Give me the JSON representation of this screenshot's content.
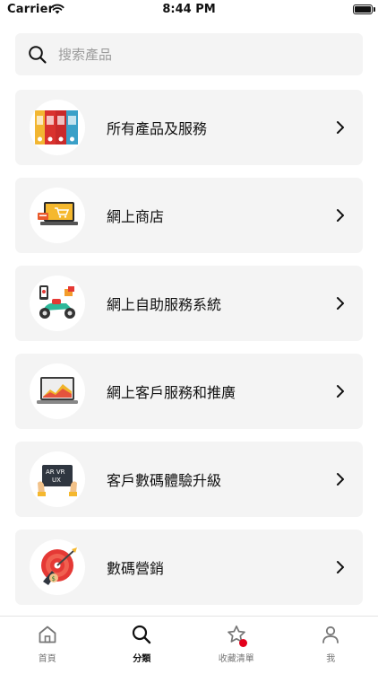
{
  "status_bar": {
    "carrier": "Carrier",
    "time": "8:44 PM"
  },
  "search": {
    "placeholder": "搜索產品"
  },
  "categories": [
    {
      "label": "所有產品及服務",
      "icon": "binders-icon"
    },
    {
      "label": "網上商店",
      "icon": "laptop-cart-icon"
    },
    {
      "label": "網上自助服務系統",
      "icon": "scooter-icon"
    },
    {
      "label": "網上客戶服務和推廣",
      "icon": "laptop-chart-icon"
    },
    {
      "label": "客戶數碼體驗升級",
      "icon": "ar-vr-ux-icon"
    },
    {
      "label": "數碼營銷",
      "icon": "target-icon"
    }
  ],
  "tabs": [
    {
      "label": "首頁",
      "icon": "home-icon"
    },
    {
      "label": "分類",
      "icon": "search-icon",
      "active": true
    },
    {
      "label": "收藏清單",
      "icon": "star-icon",
      "badge": true
    },
    {
      "label": "我",
      "icon": "person-icon"
    }
  ],
  "colors": {
    "accent": "#e3001b",
    "card_bg": "#f4f4f4"
  }
}
